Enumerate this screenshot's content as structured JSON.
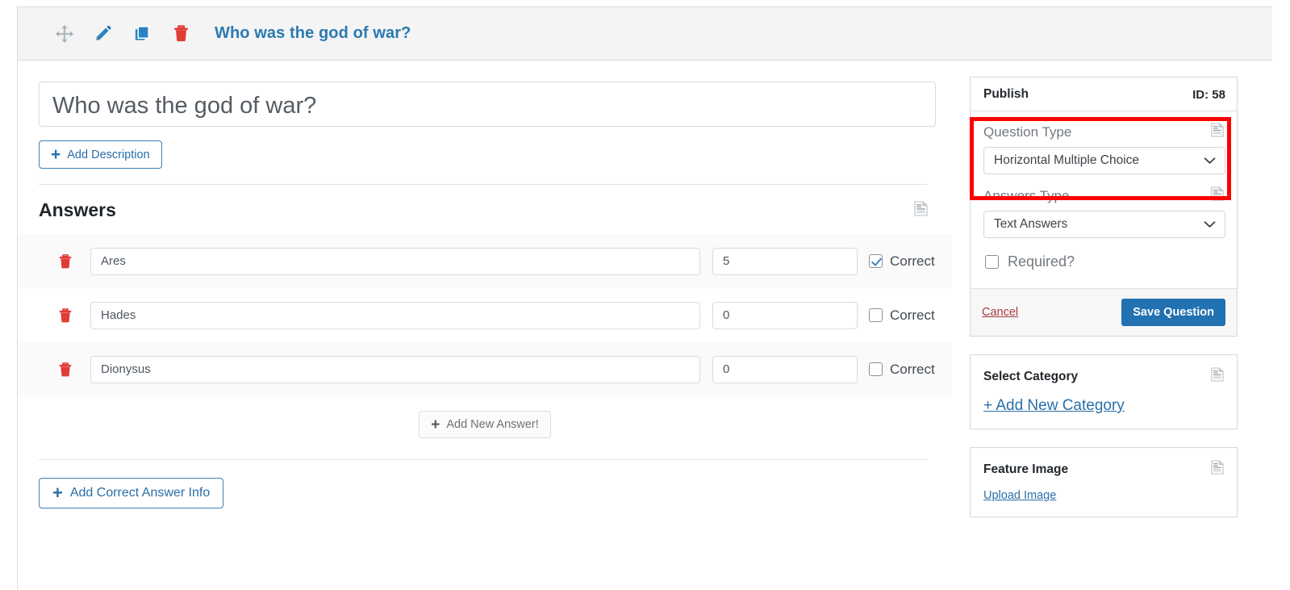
{
  "toolbar": {
    "icons": [
      {
        "name": "move-icon",
        "label": "Move"
      },
      {
        "name": "edit-pencil-icon",
        "label": "Edit"
      },
      {
        "name": "duplicate-icon",
        "label": "Duplicate"
      },
      {
        "name": "delete-trash-icon",
        "label": "Delete"
      }
    ],
    "title": "Who was the god of war?"
  },
  "question": {
    "title_value": "Who was the god of war?",
    "title_placeholder": "Who was the god of war?",
    "add_description_label": "Add Description",
    "plus": "+"
  },
  "answers": {
    "heading": "Answers",
    "correct_label": "Correct",
    "add_answer_label": "Add New Answer!",
    "rows": [
      {
        "text": "Ares",
        "score": "5",
        "correct": true
      },
      {
        "text": "Hades",
        "score": "0",
        "correct": false
      },
      {
        "text": "Dionysus",
        "score": "0",
        "correct": false
      }
    ]
  },
  "footer": {
    "add_correct_answer_info_label": "Add Correct Answer Info"
  },
  "sidebar": {
    "publish": {
      "title": "Publish",
      "id_label": "ID: 58",
      "question_type_label": "Question Type",
      "question_type_value": "Horizontal Multiple Choice",
      "answers_type_label": "Answers Type",
      "answers_type_value": "Text Answers",
      "required_label": "Required?",
      "required_checked": false,
      "cancel_label": "Cancel",
      "save_label": "Save Question"
    },
    "category": {
      "title": "Select Category",
      "add_new_label": "+ Add New Category"
    },
    "feature_image": {
      "title": "Feature Image",
      "upload_label": "Upload Image"
    }
  },
  "colors": {
    "accent_blue": "#2271b1",
    "link_blue": "#2a6fa8",
    "danger_red": "#e03b35",
    "highlight_red": "#fe0000",
    "cancel_red": "#a63b3b"
  }
}
